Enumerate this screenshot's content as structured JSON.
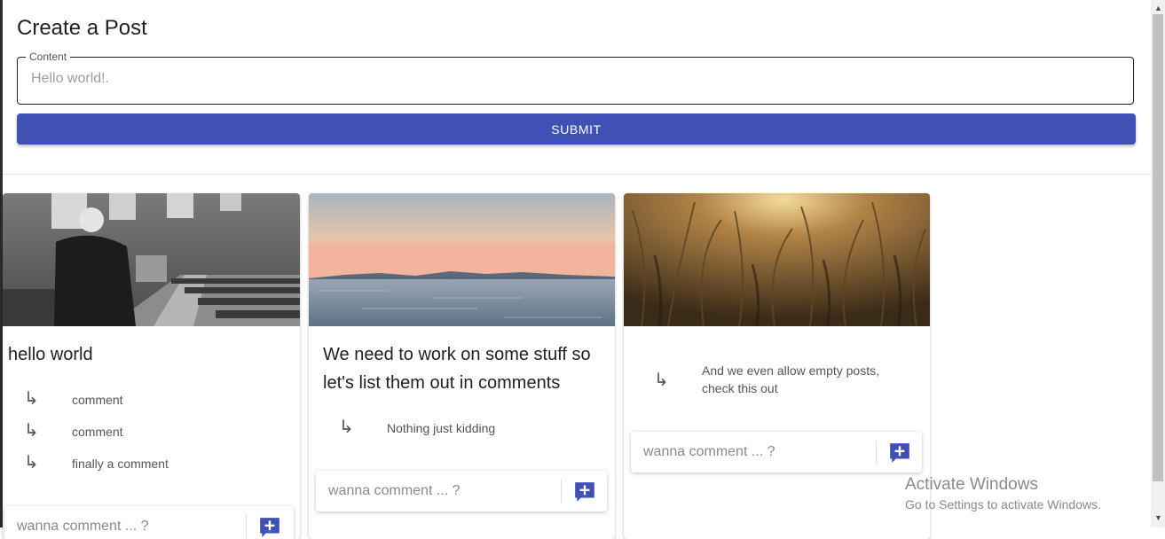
{
  "create_post": {
    "title": "Create a Post",
    "content_label": "Content",
    "content_placeholder": "Hello world!.",
    "content_value": "",
    "submit_label": "SUBMIT"
  },
  "posts": [
    {
      "title": "hello world",
      "image": "old man sitting in church pews",
      "comments": [
        "comment",
        "comment",
        "finally a comment"
      ],
      "comment_placeholder": "wanna comment ... ?"
    },
    {
      "title": "We need to work on some stuff so let's list them out in comments",
      "image": "lake at sunset with mountains",
      "comments": [
        "Nothing just kidding"
      ],
      "comment_placeholder": "wanna comment ... ?"
    },
    {
      "title": "",
      "image": "sunlit tall grass",
      "comments": [
        "And we even allow empty posts, check this out"
      ],
      "comment_placeholder": "wanna comment ... ?"
    }
  ],
  "icons": {
    "reply": "subdirectory-arrow-right-icon",
    "add_comment": "add-comment-icon"
  },
  "colors": {
    "primary": "#3f51b5",
    "text": "#212121",
    "secondary_text": "#555555"
  },
  "watermark": {
    "title": "Activate Windows",
    "subtitle": "Go to Settings to activate Windows."
  }
}
